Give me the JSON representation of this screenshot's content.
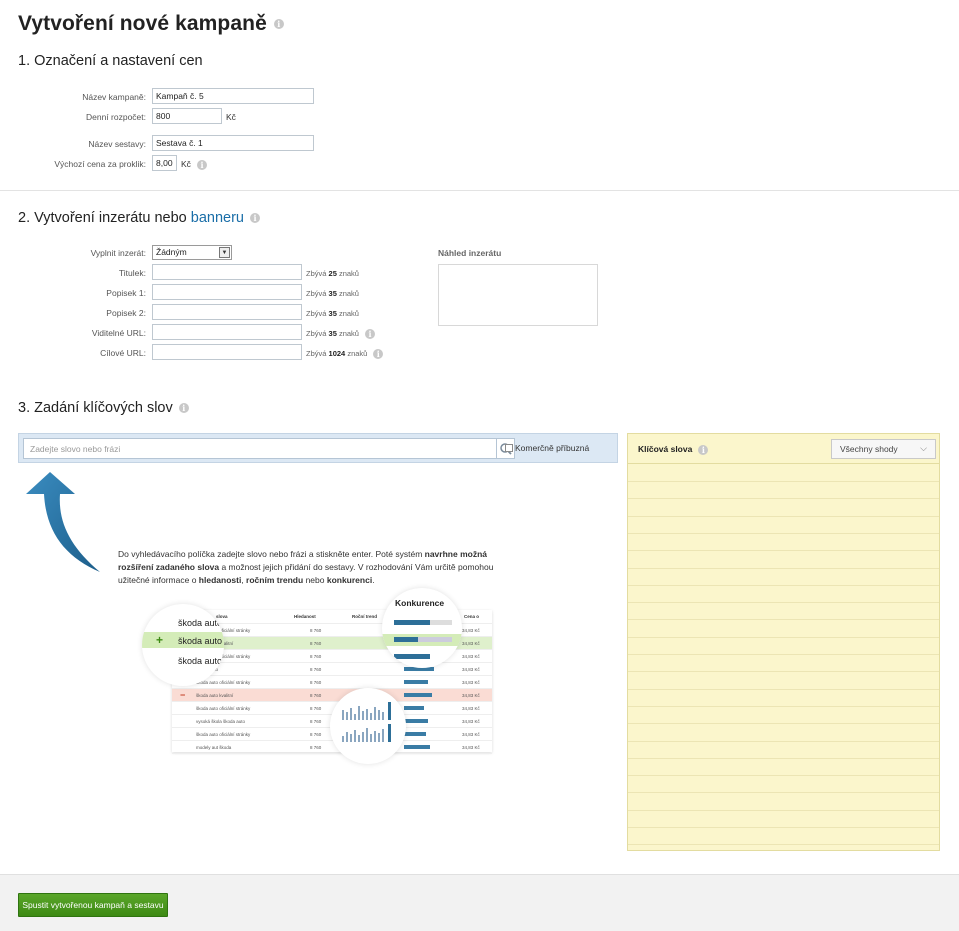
{
  "page_title": "Vytvoření nové kampaně",
  "section1": {
    "title": "1. Označení a nastavení cen",
    "campaign_name_label": "Název kampaně:",
    "campaign_name_value": "Kampaň č. 5",
    "daily_budget_label": "Denní rozpočet:",
    "daily_budget_value": "800",
    "daily_budget_unit": "Kč",
    "group_name_label": "Název sestavy:",
    "group_name_value": "Sestava č. 1",
    "default_cpc_label": "Výchozí cena za proklik:",
    "default_cpc_value": "8,00",
    "default_cpc_unit": "Kč"
  },
  "section2": {
    "title_prefix": "2. Vytvoření inzerátu nebo ",
    "title_link": "banneru",
    "fill_label": "Vyplnit inzerát:",
    "fill_value": "Žádným",
    "preview_label": "Náhled inzerátu",
    "fields": [
      {
        "label": "Titulek:",
        "rem_prefix": "Zbývá",
        "rem_num": "25",
        "rem_suffix": "znaků"
      },
      {
        "label": "Popisek 1:",
        "rem_prefix": "Zbývá",
        "rem_num": "35",
        "rem_suffix": "znaků"
      },
      {
        "label": "Popisek 2:",
        "rem_prefix": "Zbývá",
        "rem_num": "35",
        "rem_suffix": "znaků"
      },
      {
        "label": "Viditelné URL:",
        "rem_prefix": "Zbývá",
        "rem_num": "35",
        "rem_suffix": "znaků"
      },
      {
        "label": "Cílové URL:",
        "rem_prefix": "Zbývá",
        "rem_num": "1024",
        "rem_suffix": "znaků"
      }
    ]
  },
  "section3": {
    "title": "3. Zadání klíčových slov",
    "search_placeholder": "Zadejte slovo nebo frázi",
    "commercial_label": "Komerčně příbuzná",
    "keywords_title": "Klíčová slova",
    "match_select": "Všechny shody",
    "help_text": {
      "p1": "Do vyhledávacího políčka zadejte slovo nebo frázi a stiskněte enter. Poté systém ",
      "b1": "navrhne možná rozšíření zadaného slova",
      "p2": " a možnost jejich přidání do sestavy. V rozhodování Vám určitě pomohou užitečné informace o ",
      "b2": "hledanosti",
      "p3": ", ",
      "b3": "ročním trendu",
      "p4": " nebo ",
      "b4": "konkurenci",
      "p5": "."
    },
    "illustration": {
      "head_word": "slova",
      "head_search": "Hledanost",
      "head_trend": "Roční trend",
      "head_price": "Cena o",
      "konkurence": "Konkurence",
      "zoom_rows": [
        "škoda auto",
        "škoda auto",
        "škoda auto"
      ],
      "rows": [
        {
          "word": "škoda auto oficiální stránky",
          "count": "8 760",
          "price": "34,83 Kč"
        },
        {
          "word": "škoda auto kvalitní",
          "count": "8 760",
          "price": "34,83 Kč"
        },
        {
          "word": "škoda auto oficiální stránky",
          "count": "8 760",
          "price": "34,83 Kč"
        },
        {
          "word": "škoda auto",
          "count": "8 760",
          "price": "34,83 Kč"
        },
        {
          "word": "škoda auto oficiální stránky",
          "count": "8 760",
          "price": "34,83 Kč"
        },
        {
          "word": "škoda auto kvalitní",
          "count": "8 760",
          "price": "34,83 Kč"
        },
        {
          "word": "škoda auto oficiální stránky",
          "count": "8 760",
          "price": "34,83 Kč"
        },
        {
          "word": "vysoká škola škoda auto",
          "count": "8 760",
          "price": "34,83 Kč"
        },
        {
          "word": "škoda auto oficiální stránky",
          "count": "8 760",
          "price": "34,83 Kč"
        },
        {
          "word": "modely aut škoda",
          "count": "8 760",
          "price": "34,83 Kč"
        }
      ]
    }
  },
  "footer": {
    "submit_label": "Spustit vytvořenou kampaň a sestavu"
  },
  "colors": {
    "accent_blue": "#1a6ea8",
    "green_button": "#3d8a14",
    "keyword_panel": "#fbf6cc"
  }
}
